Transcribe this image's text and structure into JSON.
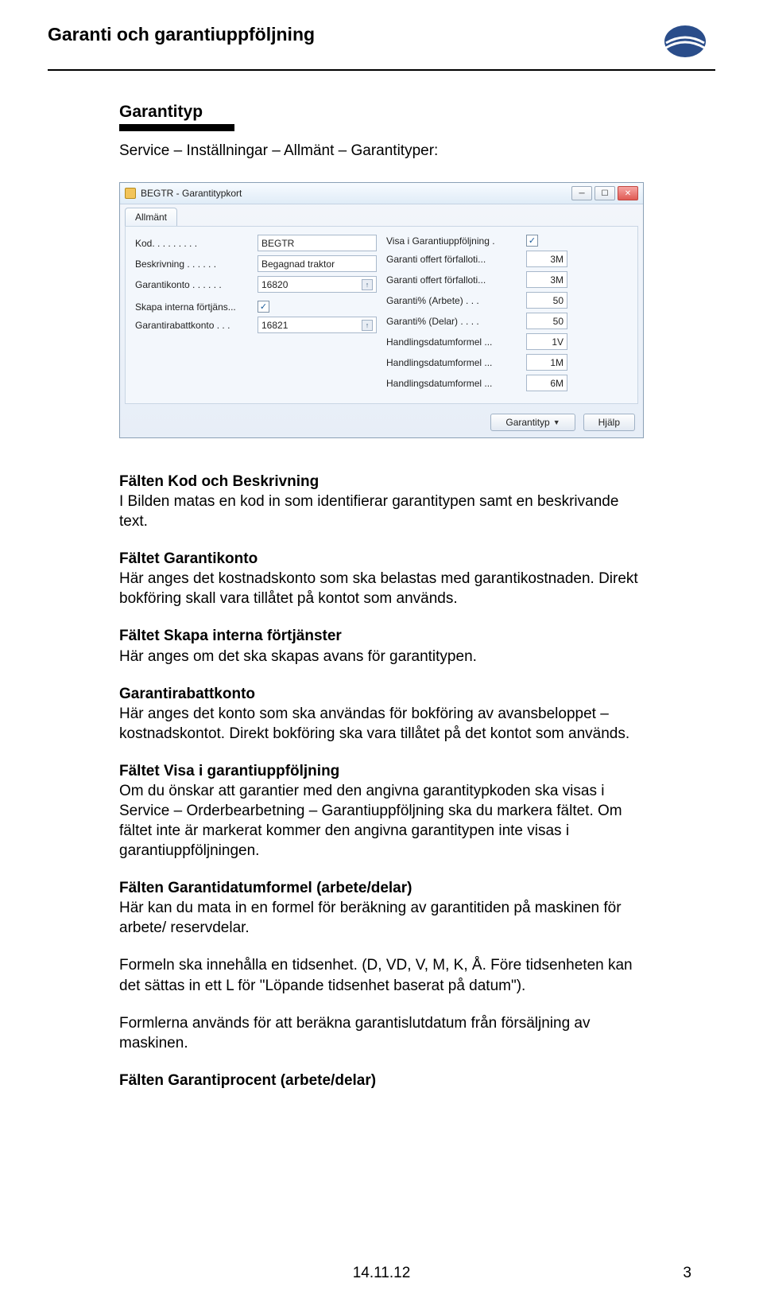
{
  "header": {
    "title": "Garanti och garantiuppföljning"
  },
  "section": {
    "heading": "Garantityp",
    "breadcrumb": "Service – Inställningar – Allmänt – Garantityper:"
  },
  "window": {
    "title": "BEGTR - Garantitypkort",
    "tab": "Allmänt",
    "left_fields": {
      "kod_label": "Kod. . . . . . . . .",
      "kod_value": "BEGTR",
      "beskrivning_label": "Beskrivning . . . . . .",
      "beskrivning_value": "Begagnad traktor",
      "garantikonto_label": "Garantikonto . . . . . .",
      "garantikonto_value": "16820",
      "skapa_label": "Skapa interna förtjäns...",
      "skapa_checked": "✓",
      "rabattkonto_label": "Garantirabattkonto  .  .  .",
      "rabattkonto_value": "16821"
    },
    "right_fields": {
      "visa_label": "Visa i Garantiuppföljning .",
      "visa_checked": "✓",
      "offert1_label": "Garanti offert förfalloti...",
      "offert1_value": "3M",
      "offert2_label": "Garanti offert förfalloti...",
      "offert2_value": "3M",
      "garanti_arbete_label": "Garanti% (Arbete)  .  .  .",
      "garanti_arbete_value": "50",
      "garanti_delar_label": "Garanti% (Delar) .  .  .  .",
      "garanti_delar_value": "50",
      "hdf1_label": "Handlingsdatumformel ...",
      "hdf1_value": "1V",
      "hdf2_label": "Handlingsdatumformel ...",
      "hdf2_value": "1M",
      "hdf3_label": "Handlingsdatumformel ...",
      "hdf3_value": "6M"
    },
    "buttons": {
      "garantityp": "Garantityp",
      "hjalp": "Hjälp"
    }
  },
  "doc": {
    "b1_title": "Fälten Kod och Beskrivning",
    "b1_text": "I Bilden matas en kod in som identifierar garantitypen samt en beskrivande text.",
    "b2_title": "Fältet Garantikonto",
    "b2_text": "Här anges det kostnadskonto som ska belastas med garantikostnaden. Direkt bokföring skall vara tillåtet på kontot som används.",
    "b3_title": "Fältet Skapa interna förtjänster",
    "b3_text": "Här anges om det ska skapas avans för garantitypen.",
    "b4_title": "Garantirabattkonto",
    "b4_text": "Här anges det konto som ska användas för bokföring av avansbeloppet – kostnadskontot. Direkt bokföring ska vara tillåtet på det kontot som används.",
    "b5_title": "Fältet Visa i garantiuppföljning",
    "b5_text": "Om du önskar att garantier med den angivna garantitypkoden ska visas i Service – Orderbearbetning – Garantiuppföljning ska du markera fältet. Om fältet inte är markerat kommer den angivna garantitypen inte visas i garantiuppföljningen.",
    "b6_title": "Fälten Garantidatumformel (arbete/delar)",
    "b6_text": "Här kan du mata in en formel för beräkning av garantitiden på maskinen för arbete/ reservdelar.",
    "b7_text": "Formeln ska innehålla en tidsenhet. (D, VD, V, M, K, Å. Före tidsenheten kan det sättas in ett L för \"Löpande tidsenhet baserat på datum\").",
    "b8_text": "Formlerna används för att beräkna garantislutdatum från försäljning av maskinen.",
    "b9_title": "Fälten Garantiprocent (arbete/delar)"
  },
  "footer": {
    "date": "14.11.12",
    "page": "3"
  }
}
